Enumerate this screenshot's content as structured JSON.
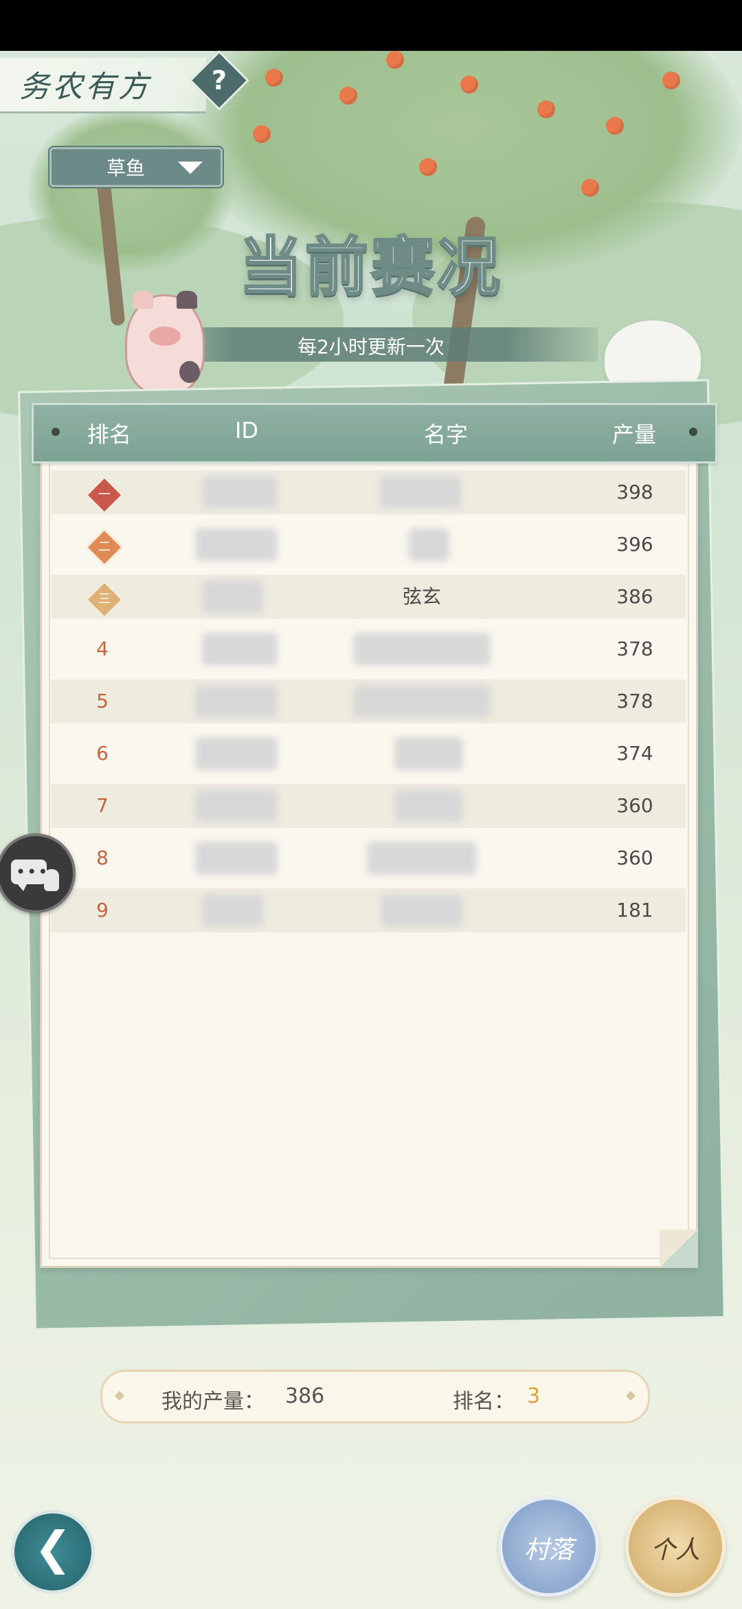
{
  "header": {
    "game_title": "务农有方",
    "help_icon": "question-mark-icon",
    "crop_selector": {
      "value": "草鱼",
      "icon": "chevron-down-icon"
    },
    "main_title": "当前赛况",
    "update_note": "每2小时更新一次"
  },
  "leaderboard": {
    "columns": [
      "排名",
      "ID",
      "名字",
      "产量"
    ],
    "rows": [
      {
        "rank": "一",
        "medal_color": "#c9574a",
        "name": "",
        "output": "398"
      },
      {
        "rank": "二",
        "medal_color": "#e08a55",
        "name": "",
        "output": "396"
      },
      {
        "rank": "三",
        "medal_color": "#e0b177",
        "name": "弦玄",
        "output": "386"
      },
      {
        "rank": "4",
        "name": "",
        "output": "378"
      },
      {
        "rank": "5",
        "name": "",
        "output": "378"
      },
      {
        "rank": "6",
        "name": "",
        "output": "374"
      },
      {
        "rank": "7",
        "name": "",
        "output": "360"
      },
      {
        "rank": "8",
        "name": "",
        "output": "360"
      },
      {
        "rank": "9",
        "name": "",
        "output": "181"
      }
    ]
  },
  "summary": {
    "my_output_label": "我的产量：",
    "my_output_value": "386",
    "rank_label": "排名：",
    "rank_value": "3"
  },
  "buttons": {
    "chat_icon": "chat-bubble-icon",
    "back_icon": "back-arrow-icon",
    "back_glyph": "❮",
    "village": "村落",
    "personal": "个人"
  },
  "colors": {
    "accent_teal": "#7da394",
    "rank_text": "#c4643a",
    "rank_highlight": "#d9a33d"
  }
}
